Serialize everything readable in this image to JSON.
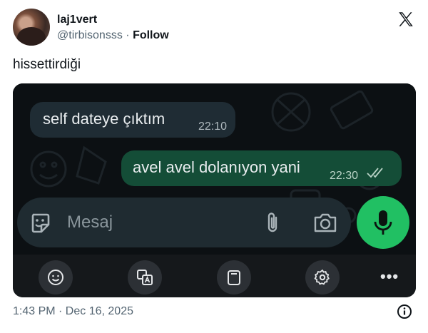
{
  "author": {
    "display_name": "laj1vert",
    "handle": "@tirbisonsss",
    "separator": "·",
    "follow_label": "Follow"
  },
  "tweet": {
    "text": "hissettirdiği",
    "timestamp": "1:43 PM · Dec 16, 2025"
  },
  "chat": {
    "messages": [
      {
        "direction": "incoming",
        "text": "self dateye çıktım",
        "time": "22:10"
      },
      {
        "direction": "outgoing",
        "text": "avel avel dolanıyon yani",
        "time": "22:30",
        "status": "read"
      }
    ],
    "composer": {
      "placeholder": "Mesaj"
    },
    "toolbar_more": "•••"
  },
  "colors": {
    "incoming_bubble": "#1f2c34",
    "outgoing_bubble": "#144d37",
    "mic_button": "#21c063",
    "handle_gray": "#536471"
  },
  "icons": [
    "x-logo-icon",
    "sticker-icon",
    "paperclip-icon",
    "camera-icon",
    "microphone-icon",
    "emoji-icon",
    "translate-icon",
    "clipboard-icon",
    "gear-icon",
    "more-icon",
    "info-icon",
    "read-ticks-icon"
  ]
}
